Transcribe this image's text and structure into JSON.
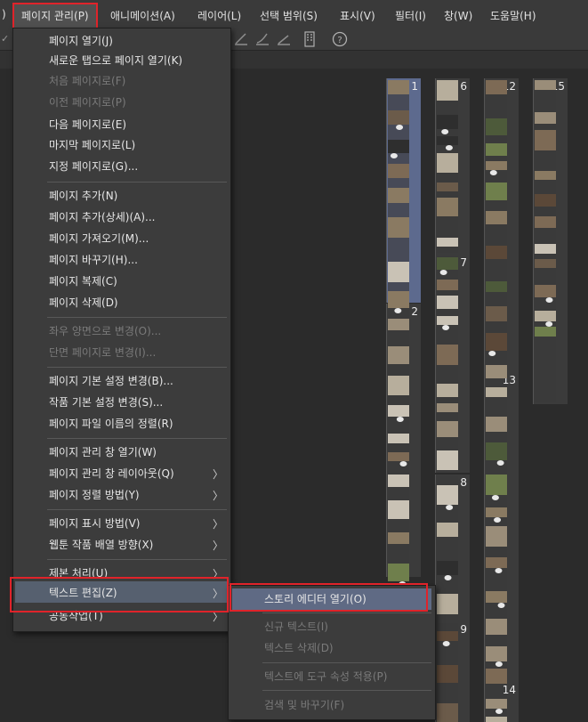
{
  "menubar": {
    "partial_left": ")",
    "items": [
      {
        "label": "페이지 관리(P)"
      },
      {
        "label": "애니메이션(A)"
      },
      {
        "label": "레이어(L)"
      },
      {
        "label": "선택 범위(S)"
      },
      {
        "label": "표시(V)"
      },
      {
        "label": "필터(I)"
      },
      {
        "label": "창(W)"
      },
      {
        "label": "도움말(H)"
      }
    ]
  },
  "page_menu": {
    "items": [
      {
        "label": "페이지 열기(J)",
        "disabled": false
      },
      {
        "label": "새로운 탭으로 페이지 열기(K)",
        "disabled": false
      },
      {
        "label": "처음 페이지로(F)",
        "disabled": true
      },
      {
        "label": "이전 페이지로(P)",
        "disabled": true
      },
      {
        "label": "다음 페이지로(E)",
        "disabled": false
      },
      {
        "label": "마지막 페이지로(L)",
        "disabled": false
      },
      {
        "label": "지정 페이지로(G)...",
        "disabled": false
      },
      {
        "label": "페이지 추가(N)",
        "disabled": false
      },
      {
        "label": "페이지 추가(상세)(A)...",
        "disabled": false
      },
      {
        "label": "페이지 가져오기(M)...",
        "disabled": false
      },
      {
        "label": "페이지 바꾸기(H)...",
        "disabled": false
      },
      {
        "label": "페이지 복제(C)",
        "disabled": false
      },
      {
        "label": "페이지 삭제(D)",
        "disabled": false
      },
      {
        "label": "좌우 양면으로 변경(O)...",
        "disabled": true
      },
      {
        "label": "단면 페이지로 변경(I)...",
        "disabled": true
      },
      {
        "label": "페이지 기본 설정 변경(B)...",
        "disabled": false
      },
      {
        "label": "작품 기본 설정 변경(S)...",
        "disabled": false
      },
      {
        "label": "페이지 파일 이름의 정렬(R)",
        "disabled": false
      },
      {
        "label": "페이지 관리 창 열기(W)",
        "disabled": false
      },
      {
        "label": "페이지 관리 창 레이아웃(Q)",
        "disabled": false
      },
      {
        "label": "페이지 정렬 방법(Y)",
        "disabled": false
      },
      {
        "label": "페이지 표시 방법(V)",
        "disabled": false
      },
      {
        "label": "웹툰 작품 배열 방향(X)",
        "disabled": false
      },
      {
        "label": "제본 처리(U)",
        "disabled": false
      },
      {
        "label": "텍스트 편집(Z)",
        "disabled": false
      },
      {
        "label": "공동작업(T)",
        "disabled": false
      }
    ]
  },
  "text_edit_submenu": {
    "items": [
      {
        "label": "스토리 에디터 열기(O)",
        "disabled": false
      },
      {
        "label": "신규 텍스트(I)",
        "disabled": true
      },
      {
        "label": "텍스트 삭제(D)",
        "disabled": true
      },
      {
        "label": "텍스트에 도구 속성 적용(P)",
        "disabled": true
      },
      {
        "label": "검색 및 바꾸기(F)",
        "disabled": true
      }
    ]
  },
  "page_numbers": [
    "1",
    "2",
    "6",
    "7",
    "8",
    "9",
    "12",
    "13",
    "14",
    "15"
  ],
  "icons": [
    "pen-tool-icon",
    "brush-tool-icon",
    "ruler-tool-icon",
    "panel-icon",
    "help-icon",
    "submenu-arrow-icon"
  ],
  "colors": {
    "highlight_border": "#e0232a",
    "selected_page": "#5d6a8e",
    "menu_bg": "#3c3c3c",
    "hover_bg": "#5f6a84"
  }
}
